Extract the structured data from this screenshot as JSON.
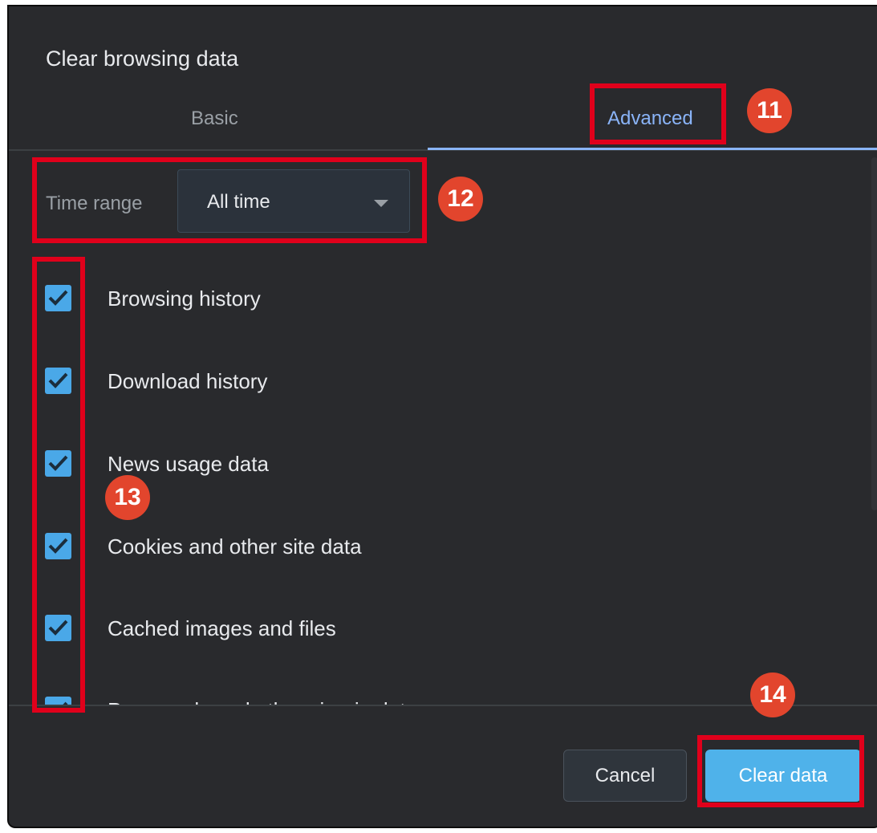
{
  "dialog": {
    "title": "Clear browsing data",
    "tabs": [
      {
        "label": "Basic",
        "active": false
      },
      {
        "label": "Advanced",
        "active": true
      }
    ]
  },
  "time_range": {
    "label": "Time range",
    "value": "All time"
  },
  "items": [
    {
      "label": "Browsing history",
      "checked": true
    },
    {
      "label": "Download history",
      "checked": true
    },
    {
      "label": "News usage data",
      "checked": true
    },
    {
      "label": "Cookies and other site data",
      "checked": true
    },
    {
      "label": "Cached images and files",
      "checked": true
    },
    {
      "label": "Passwords and other sign-in data",
      "checked": true
    }
  ],
  "buttons": {
    "cancel": "Cancel",
    "clear": "Clear data"
  },
  "annotations": [
    "11",
    "12",
    "13",
    "14"
  ],
  "colors": {
    "background": "#292a2d",
    "accent_tab": "#8ab4f8",
    "checkbox": "#4aa8e8",
    "primary_button": "#4fb2ea",
    "highlight": "#e0001b",
    "badge": "#e2452d"
  }
}
